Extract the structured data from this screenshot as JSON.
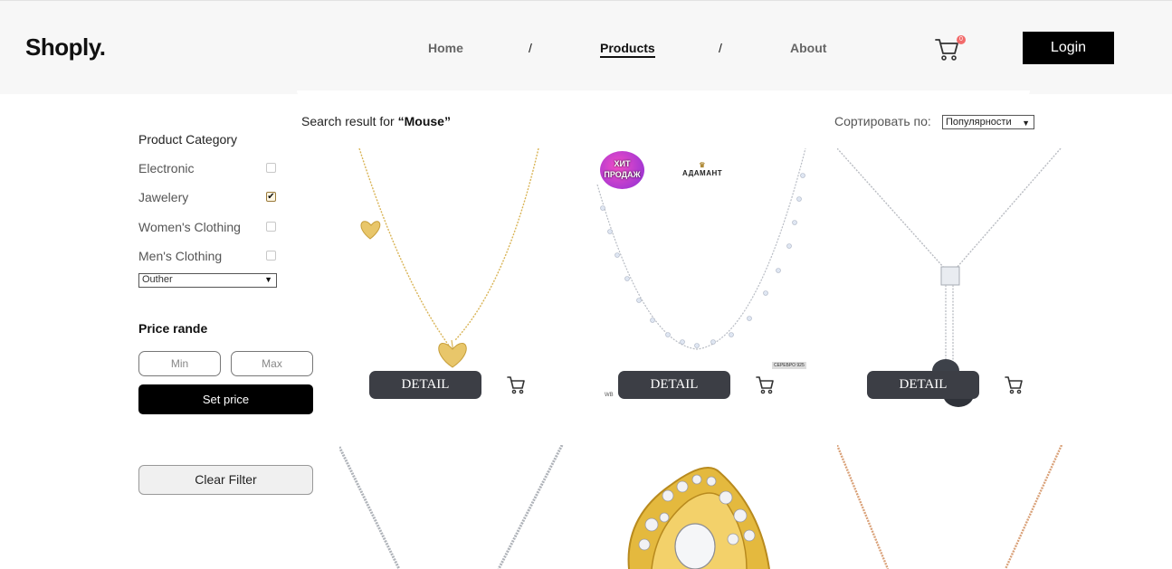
{
  "header": {
    "logo": "Shoply.",
    "nav": [
      {
        "label": "Home",
        "active": false
      },
      {
        "label": "Products",
        "active": true
      },
      {
        "label": "About",
        "active": false
      }
    ],
    "separator": "/",
    "cart_count": "0",
    "login_label": "Login"
  },
  "sidebar": {
    "category_title": "Product Category",
    "categories": [
      {
        "label": "Electronic",
        "checked": false
      },
      {
        "label": "Jawelery",
        "checked": true
      },
      {
        "label": "Women's Clothing",
        "checked": false
      },
      {
        "label": "Men's Clothing",
        "checked": false
      }
    ],
    "other_select": "Outher",
    "price_title": "Price rande",
    "min_placeholder": "Min",
    "max_placeholder": "Max",
    "set_price_label": "Set price",
    "clear_filter_label": "Clear Filter"
  },
  "results": {
    "prefix": "Search result for ",
    "query": "“Mouse”",
    "sort_label": "Сортировать по:",
    "sort_value": "Популярности"
  },
  "products": [
    {
      "detail_label": "DETAIL",
      "image": "gold-heart-necklace"
    },
    {
      "detail_label": "DETAIL",
      "image": "silver-crystal-necklace",
      "badge": "ХИТ ПРОДАЖ",
      "brand": "АДАМАНТ",
      "tag": "СЕРЕБРО 925",
      "wb": "WB"
    },
    {
      "detail_label": "DETAIL",
      "image": "silver-pearl-lariat"
    },
    {
      "image": "silver-chain"
    },
    {
      "image": "gold-diamond-ring"
    },
    {
      "image": "rose-gold-chain"
    }
  ],
  "icons": {
    "cart": "cart-icon",
    "check": "check-icon",
    "chevron": "chevron-down-icon"
  },
  "colors": {
    "accent": "#000000",
    "detail_button": "#3c3e45",
    "badge": "#f26b6b"
  }
}
